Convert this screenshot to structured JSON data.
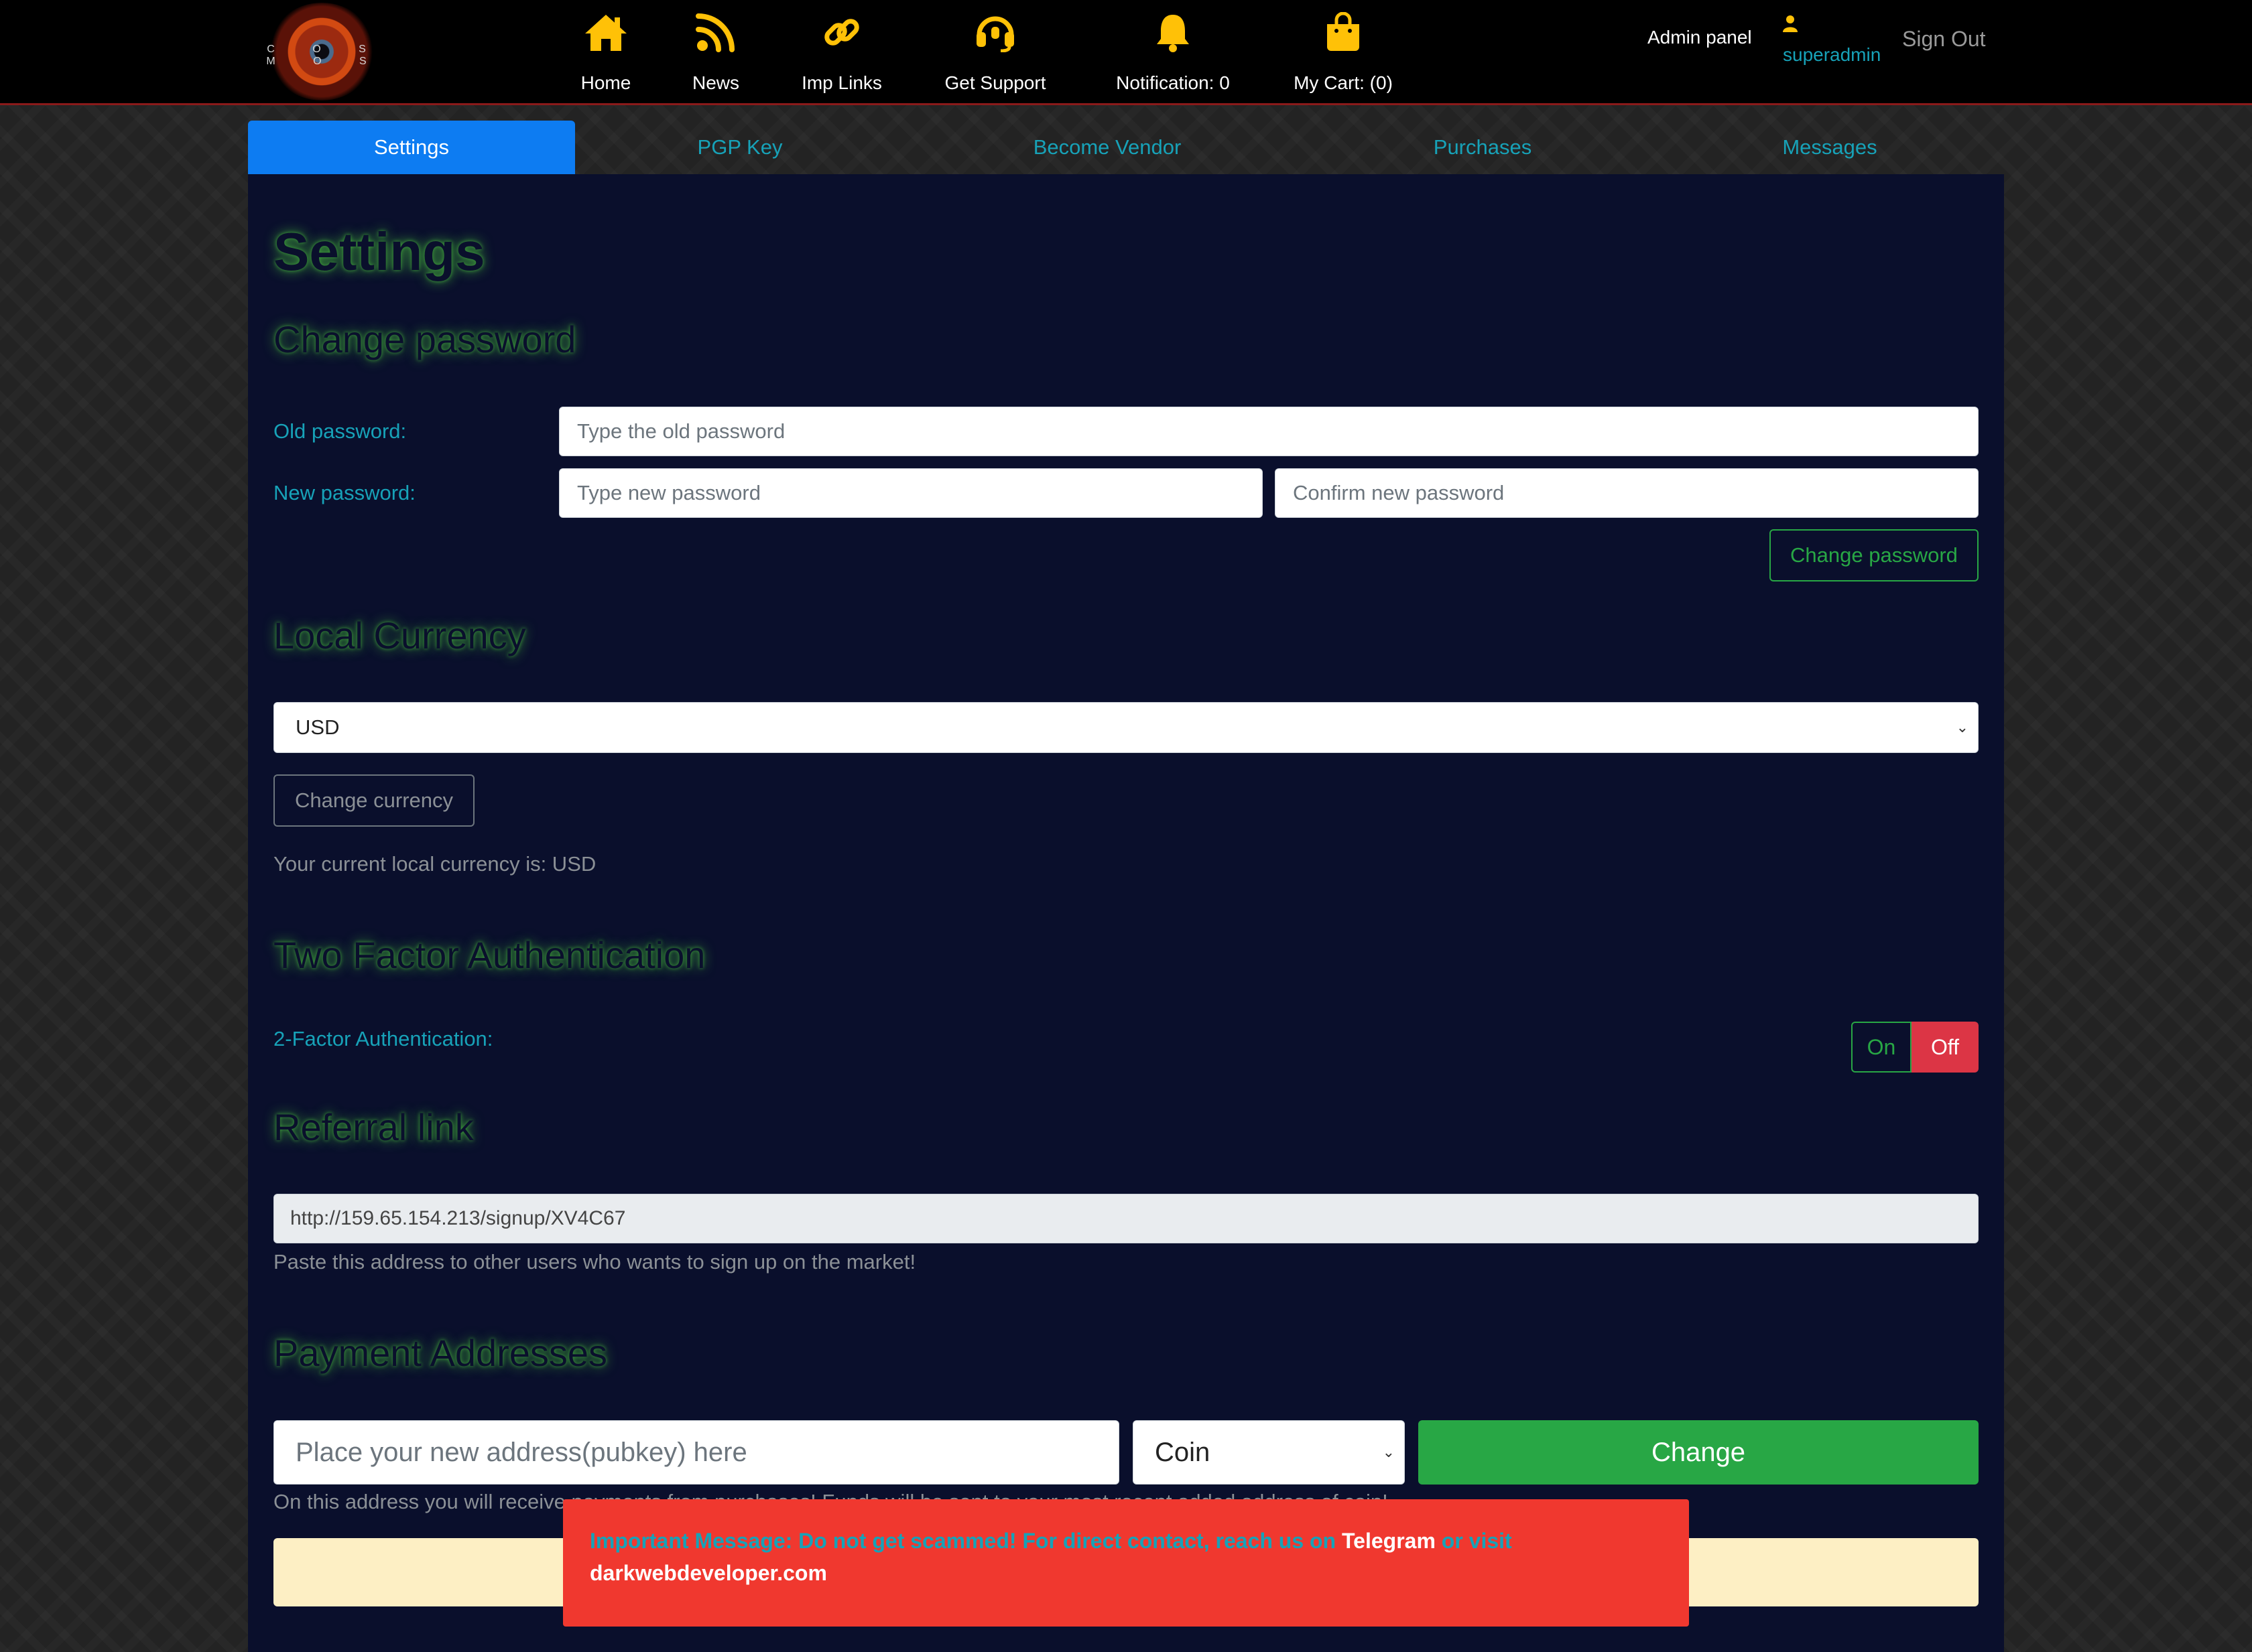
{
  "header": {
    "logo_text": "C O S M O S",
    "nav": [
      {
        "label": "Home",
        "icon": "home-icon"
      },
      {
        "label": "News",
        "icon": "rss-icon"
      },
      {
        "label": "Imp Links",
        "icon": "link-icon"
      },
      {
        "label": "Get Support",
        "icon": "headset-icon"
      },
      {
        "label": "Notification: 0",
        "icon": "bell-icon"
      },
      {
        "label": "My Cart: (0)",
        "icon": "shopping-bag-icon"
      }
    ],
    "admin_panel": "Admin panel",
    "username": "superadmin",
    "sign_out": "Sign Out"
  },
  "tabs": [
    {
      "label": "Settings",
      "active": true
    },
    {
      "label": "PGP Key",
      "active": false
    },
    {
      "label": "Become Vendor",
      "active": false
    },
    {
      "label": "Purchases",
      "active": false
    },
    {
      "label": "Messages",
      "active": false
    }
  ],
  "settings": {
    "title": "Settings",
    "password": {
      "heading": "Change password",
      "old_label": "Old password:",
      "old_placeholder": "Type the old password",
      "new_label": "New password:",
      "new_placeholder": "Type new password",
      "confirm_placeholder": "Confirm new password",
      "button": "Change password"
    },
    "currency": {
      "heading": "Local Currency",
      "selected": "USD",
      "button": "Change currency",
      "current_text": "Your current local currency is: USD"
    },
    "twofa": {
      "heading": "Two Factor Authentication",
      "label": "2-Factor Authentication:",
      "on": "On",
      "off": "Off",
      "state": "Off"
    },
    "referral": {
      "heading": "Referral link",
      "link": "http://159.65.154.213/signup/XV4C67",
      "help": "Paste this address to other users who wants to sign up on the market!"
    },
    "payment": {
      "heading": "Payment Addresses",
      "address_placeholder": "Place your new address(pubkey) here",
      "coin_selected": "Coin",
      "button": "Change",
      "help": "On this address you will receive payments from purchases! Funds will be sent to your most recent added address of coin!"
    }
  },
  "alert": {
    "intro": "Important Message: Do not get scammed! For direct contact, reach us on",
    "telegram": "Telegram",
    "or_visit": "or visit",
    "site": "darkwebdeveloper.com"
  },
  "colors": {
    "accent": "#17a2b8",
    "primary": "#0d7cf2",
    "success": "#28a745",
    "danger": "#dc3545",
    "icon": "#ffc107",
    "panel_bg": "#0a0f2c"
  }
}
